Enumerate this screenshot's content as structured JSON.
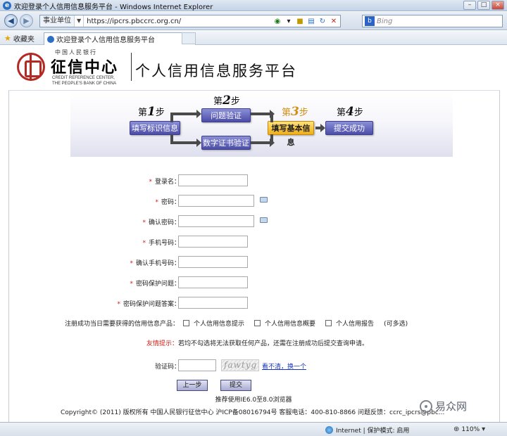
{
  "window": {
    "title": "欢迎登录个人信用信息服务平台 - Windows Internet Explorer",
    "buttons": {
      "minimize": "–",
      "maximize": "□",
      "close": "×"
    }
  },
  "addressbar": {
    "zone": "事业单位",
    "url": "https://ipcrs.pbccrc.org.cn/",
    "search_placeholder": "Bing"
  },
  "favorites": {
    "label": "收藏夹",
    "tab_title": "欢迎登录个人信用信息服务平台"
  },
  "header": {
    "logo_top": "中国人民银行",
    "logo_main": "征信中心",
    "logo_en_line1": "CREDIT REFERENCE CENTER,",
    "logo_en_line2": "THE PEOPLE'S BANK OF CHINA",
    "platform_title": "个人信用信息服务平台"
  },
  "steps": {
    "step1_prefix": "第",
    "step1_num": "1",
    "step1_suffix": "步",
    "step2_prefix": "第",
    "step2_num": "2",
    "step2_suffix": "步",
    "step3_prefix": "第",
    "step3_num": "3",
    "step3_suffix": "步",
    "step4_prefix": "第",
    "step4_num": "4",
    "step4_suffix": "步",
    "step1_box": "填写标识信息",
    "step2a_box": "问题验证",
    "step2b_box": "数字证书验证",
    "step3_box": "填写基本信息",
    "step4_box": "提交成功"
  },
  "form": {
    "required_mark": "*",
    "fields": {
      "login": "登录名：",
      "password": "密码：",
      "confirm_password": "确认密码：",
      "phone": "手机号码：",
      "confirm_phone": "确认手机号码：",
      "security_question": "密码保护问题：",
      "security_answer": "密码保护问题答案："
    },
    "products_label": "注册成功当日需要获得的信用信息产品：",
    "product_options": [
      "个人信用信息提示",
      "个人信用信息概要",
      "个人信用报告"
    ],
    "multi_select_note": "(可多选)",
    "tip_label": "友情提示：",
    "tip_text": "若均不勾选将无法获取任何产品，还需在注册成功后提交查询申请。",
    "captcha_label": "验证码：",
    "captcha_image_text": "fawtyg",
    "refresh_link": "看不清，换一个",
    "prev_button": "上一步",
    "submit_button": "提交"
  },
  "footer": {
    "browser_note": "推荐使用IE6.0至8.0浏览器",
    "copyright": "Copyright© (2011) 版权所有 中国人民银行征信中心 沪ICP备08016794号 客服电话：400-810-8866 问题反馈：ccrc_ipcrs@pbc..."
  },
  "watermark": {
    "text": "易众网"
  },
  "statusbar": {
    "zone_text": "Internet | 保护模式: 启用",
    "zoom": "110%"
  }
}
